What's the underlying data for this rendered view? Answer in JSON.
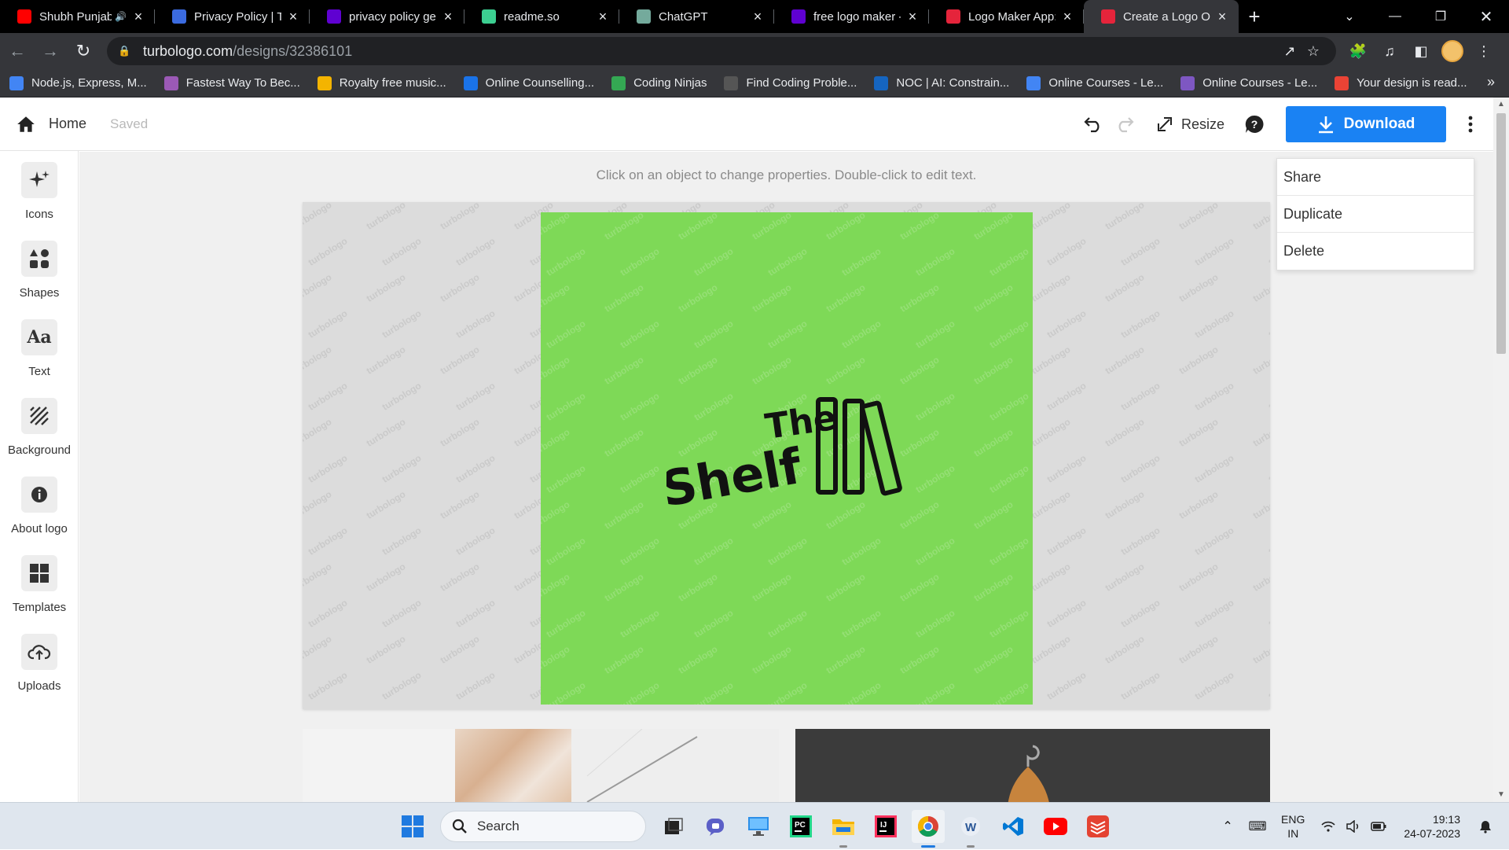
{
  "browser": {
    "tabs": [
      {
        "title": "Shubh Punjabi",
        "favicon": "youtube-icon",
        "color": "#ff0000",
        "speaker": true
      },
      {
        "title": "Privacy Policy | Th",
        "favicon": "arrow-icon",
        "color": "#3b6be0"
      },
      {
        "title": "privacy policy ger",
        "favicon": "yahoo-icon",
        "color": "#5f01d1"
      },
      {
        "title": "readme.so",
        "favicon": "readme-icon",
        "color": "#3ccf91"
      },
      {
        "title": "ChatGPT",
        "favicon": "chatgpt-icon",
        "color": "#74aa9c"
      },
      {
        "title": "free logo maker -",
        "favicon": "yahoo-icon",
        "color": "#5f01d1"
      },
      {
        "title": "Logo Maker App:",
        "favicon": "turbologo-icon",
        "color": "#e5243b"
      },
      {
        "title": "Create a Logo On",
        "favicon": "turbologo-icon",
        "color": "#e5243b",
        "active": true
      }
    ],
    "url_domain": "turbologo.com",
    "url_path": "/designs/32386101",
    "bookmarks": [
      {
        "label": "Node.js, Express, M...",
        "color": "#4285f4"
      },
      {
        "label": "Fastest Way To Bec...",
        "color": "#9b59b6"
      },
      {
        "label": "Royalty free music...",
        "color": "#f4b400"
      },
      {
        "label": "Online Counselling...",
        "color": "#1a73e8"
      },
      {
        "label": "Coding Ninjas",
        "color": "#34a853"
      },
      {
        "label": "Find Coding Proble...",
        "color": "#555555"
      },
      {
        "label": "NOC | AI: Constrain...",
        "color": "#1565c0"
      },
      {
        "label": "Online Courses - Le...",
        "color": "#4285f4"
      },
      {
        "label": "Online Courses - Le...",
        "color": "#7e57c2"
      },
      {
        "label": "Your design is read...",
        "color": "#ea4335"
      }
    ]
  },
  "app": {
    "home_label": "Home",
    "saved_label": "Saved",
    "resize_label": "Resize",
    "download_label": "Download",
    "accent_color": "#1a82f3",
    "sidebar": [
      {
        "label": "Icons",
        "icon": "sparkle-icon"
      },
      {
        "label": "Shapes",
        "icon": "shapes-icon"
      },
      {
        "label": "Text",
        "icon": "text-icon"
      },
      {
        "label": "Background",
        "icon": "background-icon"
      },
      {
        "label": "About logo",
        "icon": "info-icon"
      },
      {
        "label": "Templates",
        "icon": "templates-icon"
      },
      {
        "label": "Uploads",
        "icon": "upload-icon"
      }
    ],
    "hint": "Click on an object to change properties. Double-click to edit text.",
    "watermark": "turbologo",
    "logo": {
      "line1": "The",
      "line2": "Shelf",
      "background": "#7ed957"
    },
    "context_menu": [
      "Share",
      "Duplicate",
      "Delete"
    ]
  },
  "taskbar": {
    "search_label": "Search",
    "lang_line1": "ENG",
    "lang_line2": "IN",
    "time": "19:13",
    "date": "24-07-2023"
  }
}
